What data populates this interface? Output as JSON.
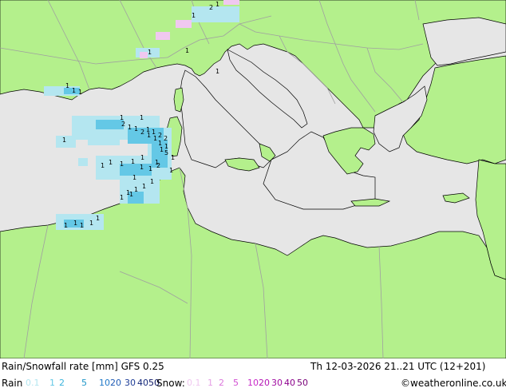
{
  "footer": {
    "title": "Rain/Snowfall rate [mm] GFS 0.25",
    "datetime": "Th 12-03-2026 21..21 UTC (12+201)",
    "rain_label": "Rain",
    "snow_label": "Snow:",
    "credit": "©weatheronline.co.uk"
  },
  "legend": {
    "rain": [
      {
        "label": "0.1",
        "color": "#b4e6f0"
      },
      {
        "label": "1",
        "color": "#64c8e6"
      },
      {
        "label": "2",
        "color": "#3cb4dc"
      },
      {
        "label": "5",
        "color": "#1e96c8"
      },
      {
        "label": "10",
        "color": "#1e78c8"
      },
      {
        "label": "20",
        "color": "#1e5ab4"
      },
      {
        "label": "30",
        "color": "#1e3c96"
      },
      {
        "label": "40",
        "color": "#14287a"
      },
      {
        "label": "50",
        "color": "#0a1464"
      }
    ],
    "snow": [
      {
        "label": "0.1",
        "color": "#f0c8f0"
      },
      {
        "label": "1",
        "color": "#e6a0e6"
      },
      {
        "label": "2",
        "color": "#dc78dc"
      },
      {
        "label": "5",
        "color": "#d250d2"
      },
      {
        "label": "10",
        "color": "#c828c8"
      },
      {
        "label": "20",
        "color": "#b414b4"
      },
      {
        "label": "30",
        "color": "#a00aa0"
      },
      {
        "label": "40",
        "color": "#8c008c"
      },
      {
        "label": "50",
        "color": "#780078"
      }
    ]
  },
  "map": {
    "land_color": "#b4f08c",
    "sea_color": "#e6e6e6",
    "border_color": "#a0a0a0",
    "coast_color": "#000000",
    "precip_values": [
      "1",
      "1",
      "1",
      "1",
      "2",
      "1",
      "1",
      "1",
      "1",
      "1",
      "1",
      "2",
      "1",
      "1",
      "2",
      "1",
      "1",
      "1",
      "1",
      "2",
      "2",
      "1",
      "1",
      "1",
      "5",
      "1",
      "1",
      "1",
      "1",
      "1",
      "1",
      "1",
      "1",
      "2",
      "1",
      "1",
      "1",
      "1",
      "1",
      "1",
      "1",
      "1",
      "1",
      "1",
      "1",
      "1",
      "1",
      "1",
      "1"
    ]
  }
}
